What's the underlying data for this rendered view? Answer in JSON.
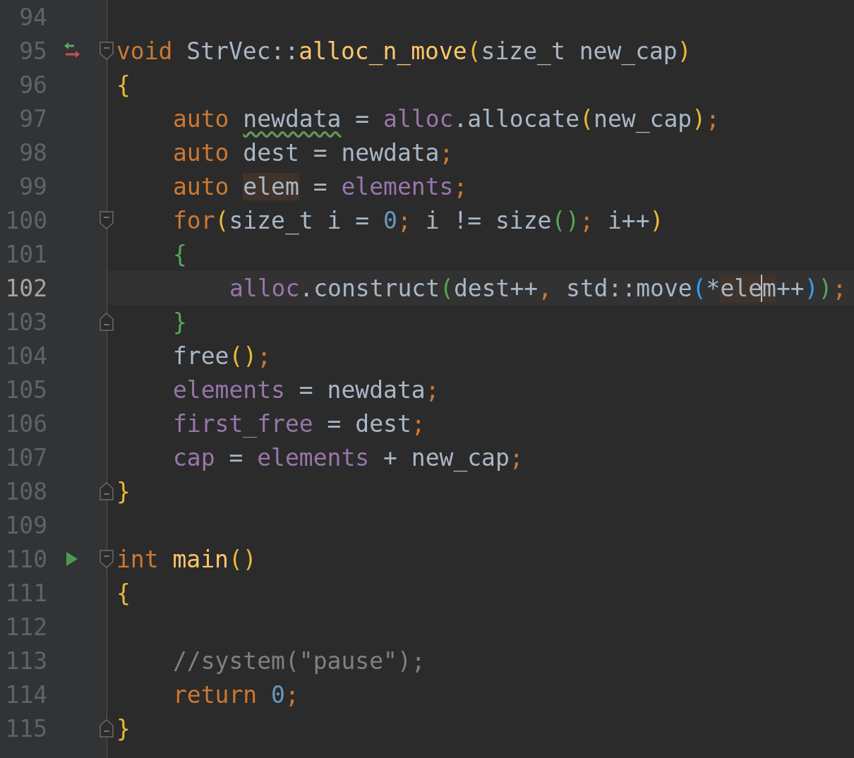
{
  "lines": [
    {
      "number": "94",
      "current": false
    },
    {
      "number": "95",
      "current": false,
      "marker": {
        "kind": "override"
      },
      "fold": {
        "kind": "start"
      },
      "tokens": [
        {
          "text": "void ",
          "kind": "keyword"
        },
        {
          "text": "StrVec::",
          "kind": "plain"
        },
        {
          "text": "alloc_n_move",
          "kind": "function"
        },
        {
          "text": "(",
          "kind": "brace1"
        },
        {
          "text": "size_t new_cap",
          "kind": "plain"
        },
        {
          "text": ")",
          "kind": "brace1"
        }
      ]
    },
    {
      "number": "96",
      "current": false,
      "tokens": [
        {
          "text": "{",
          "kind": "brace1"
        }
      ]
    },
    {
      "number": "97",
      "current": false,
      "indent": {
        "kind": "one"
      },
      "tokens": [
        {
          "text": "auto ",
          "kind": "keyword"
        },
        {
          "text": "newdata",
          "kind": "plain",
          "warning": true
        },
        {
          "text": " = ",
          "kind": "plain"
        },
        {
          "text": "alloc",
          "kind": "field"
        },
        {
          "text": ".allocate",
          "kind": "plain"
        },
        {
          "text": "(",
          "kind": "brace1"
        },
        {
          "text": "new_cap",
          "kind": "plain"
        },
        {
          "text": ")",
          "kind": "brace1"
        },
        {
          "text": ";",
          "kind": "keyword"
        }
      ]
    },
    {
      "number": "98",
      "current": false,
      "indent": {
        "kind": "one"
      },
      "tokens": [
        {
          "text": "auto ",
          "kind": "keyword"
        },
        {
          "text": "dest = newdata",
          "kind": "plain"
        },
        {
          "text": ";",
          "kind": "keyword"
        }
      ]
    },
    {
      "number": "99",
      "current": false,
      "indent": {
        "kind": "one"
      },
      "tokens": [
        {
          "text": "auto ",
          "kind": "keyword"
        },
        {
          "text": "elem",
          "kind": "plain",
          "highlight": true
        },
        {
          "text": " = ",
          "kind": "plain"
        },
        {
          "text": "elements",
          "kind": "field"
        },
        {
          "text": ";",
          "kind": "keyword"
        }
      ]
    },
    {
      "number": "100",
      "current": false,
      "indent": {
        "kind": "one"
      },
      "fold": {
        "kind": "start"
      },
      "tokens": [
        {
          "text": "for",
          "kind": "keyword"
        },
        {
          "text": "(",
          "kind": "brace1"
        },
        {
          "text": "size_t i = ",
          "kind": "plain"
        },
        {
          "text": "0",
          "kind": "number"
        },
        {
          "text": ";",
          "kind": "keyword"
        },
        {
          "text": " i != size",
          "kind": "plain"
        },
        {
          "text": "()",
          "kind": "brace2"
        },
        {
          "text": ";",
          "kind": "keyword"
        },
        {
          "text": " i++",
          "kind": "plain"
        },
        {
          "text": ")",
          "kind": "brace1"
        }
      ]
    },
    {
      "number": "101",
      "current": false,
      "indent": {
        "kind": "one"
      },
      "tokens": [
        {
          "text": "{",
          "kind": "brace2"
        }
      ]
    },
    {
      "number": "102",
      "current": true,
      "indent": {
        "kind": "two"
      },
      "tokens": [
        {
          "text": "alloc",
          "kind": "field"
        },
        {
          "text": ".construct",
          "kind": "plain"
        },
        {
          "text": "(",
          "kind": "brace2"
        },
        {
          "text": "dest++",
          "kind": "plain"
        },
        {
          "text": ", ",
          "kind": "keyword"
        },
        {
          "text": "std::move",
          "kind": "plain"
        },
        {
          "text": "(",
          "kind": "brace3"
        },
        {
          "text": "*",
          "kind": "plain"
        },
        {
          "text": "ele",
          "kind": "plain",
          "highlight": true,
          "caret": true
        },
        {
          "text": "m",
          "kind": "plain",
          "highlight": true
        },
        {
          "text": "++",
          "kind": "plain"
        },
        {
          "text": ")",
          "kind": "brace3"
        },
        {
          "text": ")",
          "kind": "brace2"
        },
        {
          "text": ";",
          "kind": "keyword"
        }
      ]
    },
    {
      "number": "103",
      "current": false,
      "indent": {
        "kind": "one"
      },
      "fold": {
        "kind": "end"
      },
      "tokens": [
        {
          "text": "}",
          "kind": "brace2"
        }
      ]
    },
    {
      "number": "104",
      "current": false,
      "indent": {
        "kind": "one"
      },
      "tokens": [
        {
          "text": "free",
          "kind": "plain"
        },
        {
          "text": "()",
          "kind": "brace1"
        },
        {
          "text": ";",
          "kind": "keyword"
        }
      ]
    },
    {
      "number": "105",
      "current": false,
      "indent": {
        "kind": "one"
      },
      "tokens": [
        {
          "text": "elements",
          "kind": "field"
        },
        {
          "text": " = newdata",
          "kind": "plain"
        },
        {
          "text": ";",
          "kind": "keyword"
        }
      ]
    },
    {
      "number": "106",
      "current": false,
      "indent": {
        "kind": "one"
      },
      "tokens": [
        {
          "text": "first_free",
          "kind": "field"
        },
        {
          "text": " = dest",
          "kind": "plain"
        },
        {
          "text": ";",
          "kind": "keyword"
        }
      ]
    },
    {
      "number": "107",
      "current": false,
      "indent": {
        "kind": "one"
      },
      "tokens": [
        {
          "text": "cap",
          "kind": "field"
        },
        {
          "text": " = ",
          "kind": "plain"
        },
        {
          "text": "elements",
          "kind": "field"
        },
        {
          "text": " + new_cap",
          "kind": "plain"
        },
        {
          "text": ";",
          "kind": "keyword"
        }
      ]
    },
    {
      "number": "108",
      "current": false,
      "fold": {
        "kind": "end"
      },
      "tokens": [
        {
          "text": "}",
          "kind": "brace1"
        }
      ]
    },
    {
      "number": "109",
      "current": false
    },
    {
      "number": "110",
      "current": false,
      "marker": {
        "kind": "run"
      },
      "fold": {
        "kind": "start"
      },
      "tokens": [
        {
          "text": "int ",
          "kind": "keyword"
        },
        {
          "text": "main",
          "kind": "function"
        },
        {
          "text": "()",
          "kind": "brace1"
        }
      ]
    },
    {
      "number": "111",
      "current": false,
      "tokens": [
        {
          "text": "{",
          "kind": "brace1"
        }
      ]
    },
    {
      "number": "112",
      "current": false
    },
    {
      "number": "113",
      "current": false,
      "indent": {
        "kind": "one"
      },
      "tokens": [
        {
          "text": "//system(\"pause\");",
          "kind": "comment"
        }
      ]
    },
    {
      "number": "114",
      "current": false,
      "indent": {
        "kind": "one"
      },
      "tokens": [
        {
          "text": "return ",
          "kind": "keyword"
        },
        {
          "text": "0",
          "kind": "number"
        },
        {
          "text": ";",
          "kind": "keyword"
        }
      ]
    },
    {
      "number": "115",
      "current": false,
      "fold": {
        "kind": "end"
      },
      "tokens": [
        {
          "text": "}",
          "kind": "brace1"
        }
      ]
    }
  ]
}
